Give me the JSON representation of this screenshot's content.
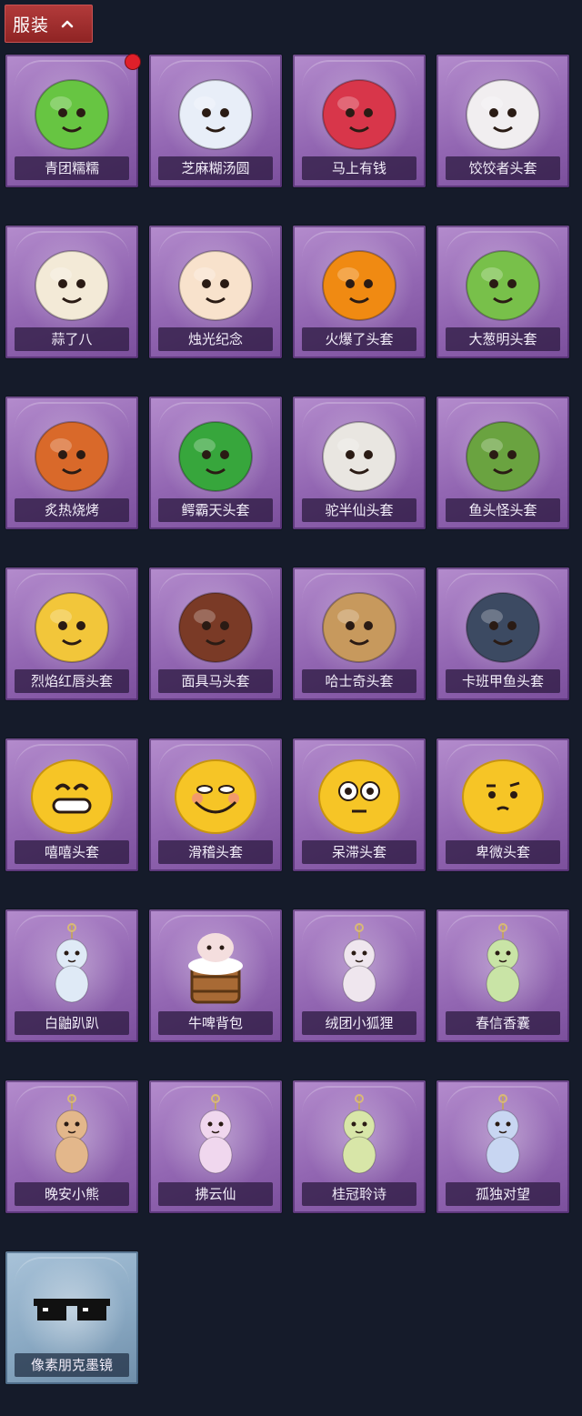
{
  "section": {
    "title": "服装",
    "expanded": true
  },
  "accent": "#b23a3a",
  "items": [
    {
      "name": "青团糯糯",
      "icon": "green-rice-ball-icon",
      "color": "#67c542",
      "new": true
    },
    {
      "name": "芝麻糊汤圆",
      "icon": "rice-dumpling-icon",
      "color": "#e8eef8"
    },
    {
      "name": "马上有钱",
      "icon": "red-horse-head-icon",
      "color": "#d8364a"
    },
    {
      "name": "饺饺者头套",
      "icon": "dumpling-head-icon",
      "color": "#f1eef0"
    },
    {
      "name": "蒜了八",
      "icon": "garlic-head-icon",
      "color": "#f3ead7"
    },
    {
      "name": "烛光纪念",
      "icon": "candle-head-icon",
      "color": "#f8e2cc"
    },
    {
      "name": "火爆了头套",
      "icon": "fire-head-icon",
      "color": "#f08a12"
    },
    {
      "name": "大葱明头套",
      "icon": "green-onion-head-icon",
      "color": "#78c04a"
    },
    {
      "name": "炙热烧烤",
      "icon": "bbq-head-icon",
      "color": "#d9692a"
    },
    {
      "name": "鳄霸天头套",
      "icon": "crocodile-head-icon",
      "color": "#37a63c"
    },
    {
      "name": "驼半仙头套",
      "icon": "panda-head-icon",
      "color": "#e9e6e1"
    },
    {
      "name": "鱼头怪头套",
      "icon": "fish-head-icon",
      "color": "#6aa340"
    },
    {
      "name": "烈焰红唇头套",
      "icon": "pikachu-head-icon",
      "color": "#f2c63a"
    },
    {
      "name": "面具马头套",
      "icon": "horse-mask-icon",
      "color": "#7a3a26"
    },
    {
      "name": "哈士奇头套",
      "icon": "husky-head-icon",
      "color": "#c7995d"
    },
    {
      "name": "卡班甲鱼头套",
      "icon": "whale-head-icon",
      "color": "#3c4a62"
    },
    {
      "name": "嘻嘻头套",
      "icon": "grin-emoji-icon",
      "color": "#f6c526"
    },
    {
      "name": "滑稽头套",
      "icon": "funny-emoji-icon",
      "color": "#f6c526"
    },
    {
      "name": "呆滞头套",
      "icon": "dazed-emoji-icon",
      "color": "#f6c526"
    },
    {
      "name": "卑微头套",
      "icon": "humble-emoji-icon",
      "color": "#f6c526"
    },
    {
      "name": "白鼬趴趴",
      "icon": "white-ferret-icon",
      "color": "#dfeaf6"
    },
    {
      "name": "牛啤背包",
      "icon": "beer-cow-backpack-icon",
      "color": "#a86a35"
    },
    {
      "name": "绒团小狐狸",
      "icon": "fox-pendant-icon",
      "color": "#efe6ee"
    },
    {
      "name": "春信香囊",
      "icon": "sachet-pendant-icon",
      "color": "#c9e4a6"
    },
    {
      "name": "晚安小熊",
      "icon": "bear-pendant-icon",
      "color": "#e3b78b"
    },
    {
      "name": "拂云仙",
      "icon": "fairy-pendant-icon",
      "color": "#f0d7ee"
    },
    {
      "name": "桂冠聆诗",
      "icon": "laurel-pendant-icon",
      "color": "#d8e6a8"
    },
    {
      "name": "孤独对望",
      "icon": "lonely-pendant-icon",
      "color": "#c8d6f2"
    },
    {
      "name": "像素朋克墨镜",
      "icon": "pixel-sunglasses-icon",
      "color": "#111111",
      "rarity": "blue"
    }
  ]
}
